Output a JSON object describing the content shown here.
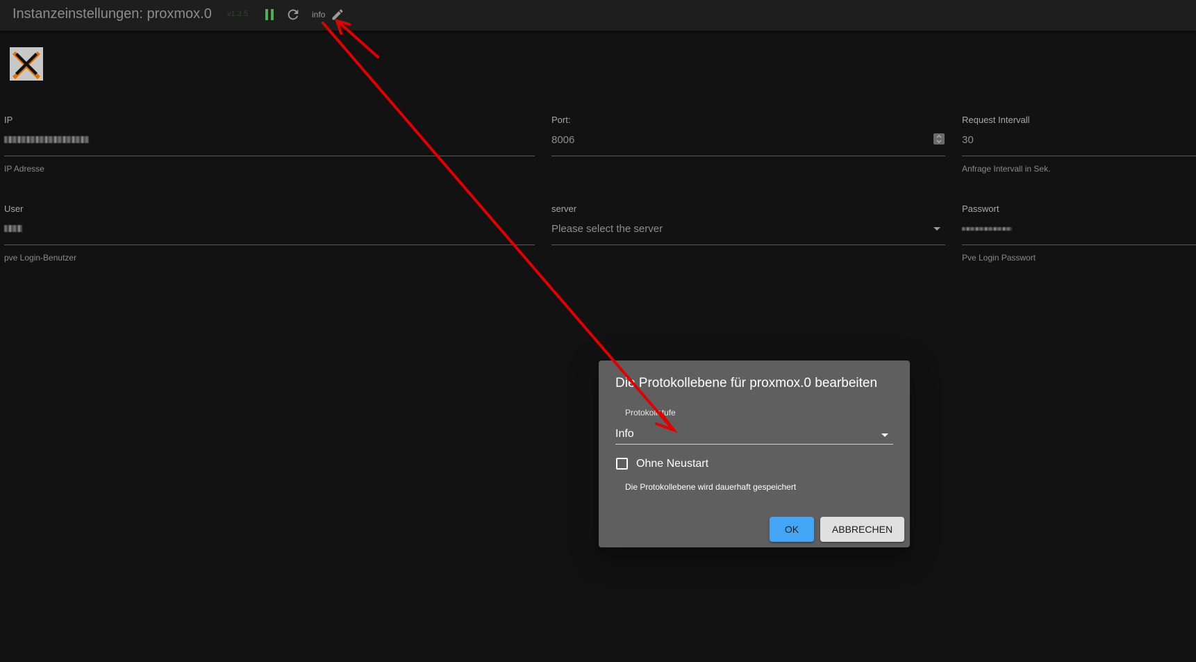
{
  "header": {
    "title": "Instanzeinstellungen: proxmox.0",
    "version": "v1.3.5",
    "log_level": "info",
    "icons": [
      "pause-icon",
      "refresh-icon",
      "edit-icon"
    ],
    "pause_color": "#4caf50"
  },
  "logo": {
    "icon": "proxmox-logo"
  },
  "fields": {
    "ip": {
      "label": "IP",
      "helper": "IP Adresse"
    },
    "port": {
      "label": "Port:",
      "value": "8006"
    },
    "interval": {
      "label": "Request Intervall",
      "value": "30",
      "helper": "Anfrage Intervall in Sek."
    },
    "user": {
      "label": "User",
      "helper": "pve Login-Benutzer"
    },
    "server": {
      "label": "server",
      "placeholder": "Please select the server"
    },
    "password": {
      "label": "Passwort",
      "helper": "Pve Login Passwort"
    }
  },
  "dialog": {
    "title": "Die Protokollebene für proxmox.0 bearbeiten",
    "select_label": "Protokollstufe",
    "select_value": "Info",
    "checkbox_label": "Ohne Neustart",
    "checkbox_checked": false,
    "hint": "Die Protokollebene wird dauerhaft gespeichert",
    "ok_label": "OK",
    "cancel_label": "ABBRECHEN",
    "ok_color": "#42a5f5"
  },
  "annotation": {
    "arrow_color": "#e00000"
  }
}
